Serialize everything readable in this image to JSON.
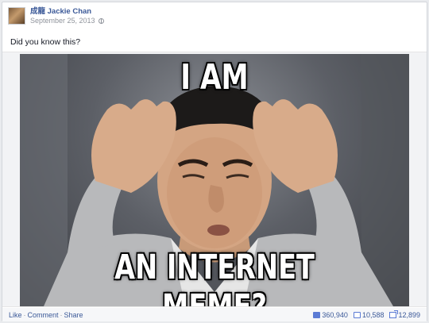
{
  "post": {
    "author": "成龍 Jackie Chan",
    "date": "September 25, 2013",
    "text": "Did you know this?",
    "image": {
      "top_caption": "I AM",
      "bottom_caption": "AN INTERNET MEME?"
    }
  },
  "footer": {
    "like_label": "Like",
    "comment_label": "Comment",
    "share_label": "Share",
    "separator": "·",
    "likes_count": "360,940",
    "comments_count": "10,588",
    "shares_count": "12,899"
  },
  "icons": {
    "privacy": "globe-icon",
    "likes": "thumbs-up-icon",
    "comments": "comment-icon",
    "shares": "share-icon"
  },
  "colors": {
    "link": "#3b5998",
    "meta": "#90949c",
    "background": "#e9ebee"
  }
}
